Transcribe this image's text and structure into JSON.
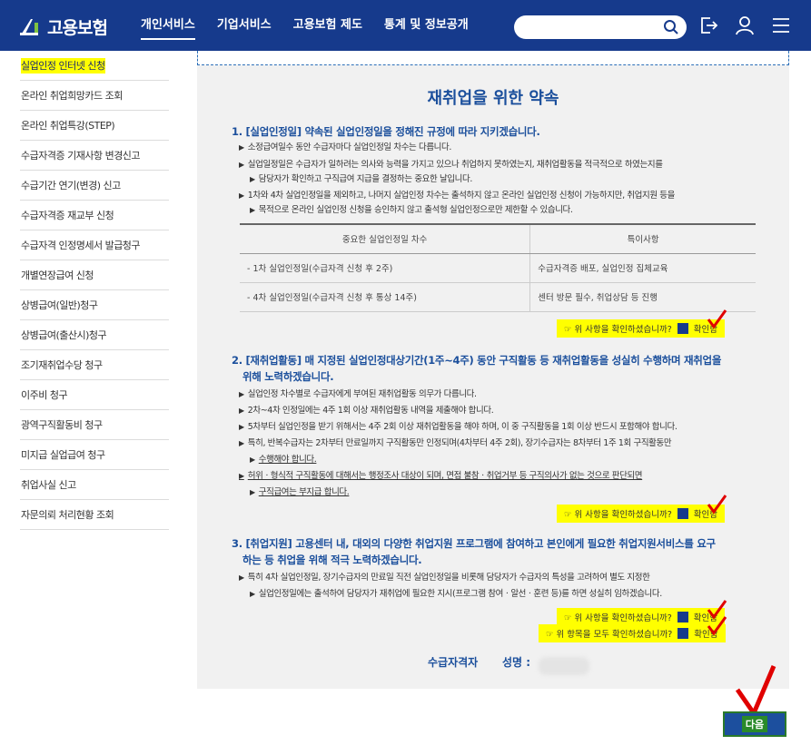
{
  "header": {
    "logo_text": "고용보험",
    "nav": [
      "개인서비스",
      "기업서비스",
      "고용보험 제도",
      "통계 및 정보공개"
    ],
    "search_placeholder": ""
  },
  "sidebar": {
    "items": [
      "실업인정 인터넷 신청",
      "온라인 취업희망카드 조회",
      "온라인 취업특강(STEP)",
      "수급자격증 기재사항 변경신고",
      "수급기간 연기(변경) 신고",
      "수급자격증 재교부 신청",
      "수급자격 인정명세서 발급청구",
      "개별연장급여 신청",
      "상병급여(일반)청구",
      "상병급여(출산시)청구",
      "조기재취업수당 청구",
      "이주비 청구",
      "광역구직활동비 청구",
      "미지급 실업급여 청구",
      "취업사실 신고",
      "자문의뢰 처리현황 조회"
    ]
  },
  "main": {
    "title": "재취업을 위한 약속",
    "s1": {
      "head": "1. [실업인정일] 약속된 실업인정일을 정해진 규정에 따라 지키겠습니다.",
      "b1": "소정급여일수 동안 수급자마다 실업인정일 차수는 다릅니다.",
      "b2a": "실업일정일은 수급자가 일하려는 의사와 능력을 가지고 있으나 취업하지 못하였는지, 재취업활동을 적극적으로 하였는지를",
      "b2b": "담당자가 확인하고 구직급여 지급을 결정하는 중요한 날입니다.",
      "b3a": "1차와 4차 실업인정일을 제외하고, 나머지 실업인정 차수는 출석하지 않고 온라인 실업인정 신청이 가능하지만, 취업지원 등을",
      "b3b": "목적으로 온라인 실업인정 신청을 승인하지 않고 출석형 실업인정으로만 제한할 수 있습니다.",
      "table_headers": [
        "중요한 실업인정일 차수",
        "특이사항"
      ],
      "table_rows": [
        [
          "- 1차 실업인정일(수급자격 신청 후 2주)",
          "수급자격증 배포, 실업인정 집체교육"
        ],
        [
          "- 4차 실업인정일(수급자격 신청 후 통상 14주)",
          "센터 방문 필수, 취업상담 등 진행"
        ]
      ]
    },
    "s2": {
      "head_a": "2. [재취업활동] 매 지정된 실업인정대상기간(1주~4주) 동안 구직활동 등 재취업활동을 성실히 수행하며 재취업을",
      "head_b": "위해 노력하겠습니다.",
      "b1": "실업인정 차수별로 수급자에게 부여된 재취업활동 의무가 다릅니다.",
      "b2": "2차~4차 인정일에는 4주 1회 이상 재취업활동 내역을 제출해야 합니다.",
      "b3": "5차부터 실업인정을 받기 위해서는 4주 2회 이상 재취업활동을 해야 하며, 이 중 구직활동을 1회 이상 반드시 포함해야 합니다.",
      "b4a": "특히, 반복수급자는 2차부터 만료일까지 구직활동만 인정되며(4차부터 4주 2회), 장기수급자는 8차부터 1주 1회 구직활동만",
      "b4b": "수행해야 합니다.",
      "b5a": "허위ㆍ형식적 구직활동에 대해서는 행정조사 대상이 되며, 면접 불참ㆍ취업거부 등 구직의사가 없는 것으로 판단되면",
      "b5b": "구직급여는 부지급 합니다."
    },
    "s3": {
      "head_a": "3. [취업지원] 고용센터 내, 대외의 다양한 취업지원 프로그램에 참여하고 본인에게 필요한 취업지원서비스를 요구",
      "head_b": "하는 등 취업을 위해 적극 노력하겠습니다.",
      "b1a": "특히 4차 실업인정일, 장기수급자의 만료일 직전 실업인정일을 비롯해 담당자가 수급자의 특성을 고려하여 별도 지정한",
      "b1b": "실업인정일에는 출석하여 담당자가 재취업에 필요한 지시(프로그램 참여ㆍ알선ㆍ훈련 등)를 하면 성실히 임하겠습니다."
    },
    "confirm_question": "☞ 위 사항을 확인하셨습니까?",
    "confirm_all_question": "☞ 위 항목을 모두 확인하셨습니까?",
    "confirm_label": "확인함",
    "sig_label": "수급자격자",
    "sig_name_label": "성명 :",
    "next_label": "다음"
  },
  "colors": {
    "header": "#163a8c",
    "accent": "#1b4f9c",
    "highlight": "#ffff00",
    "tick": "#e00000"
  }
}
